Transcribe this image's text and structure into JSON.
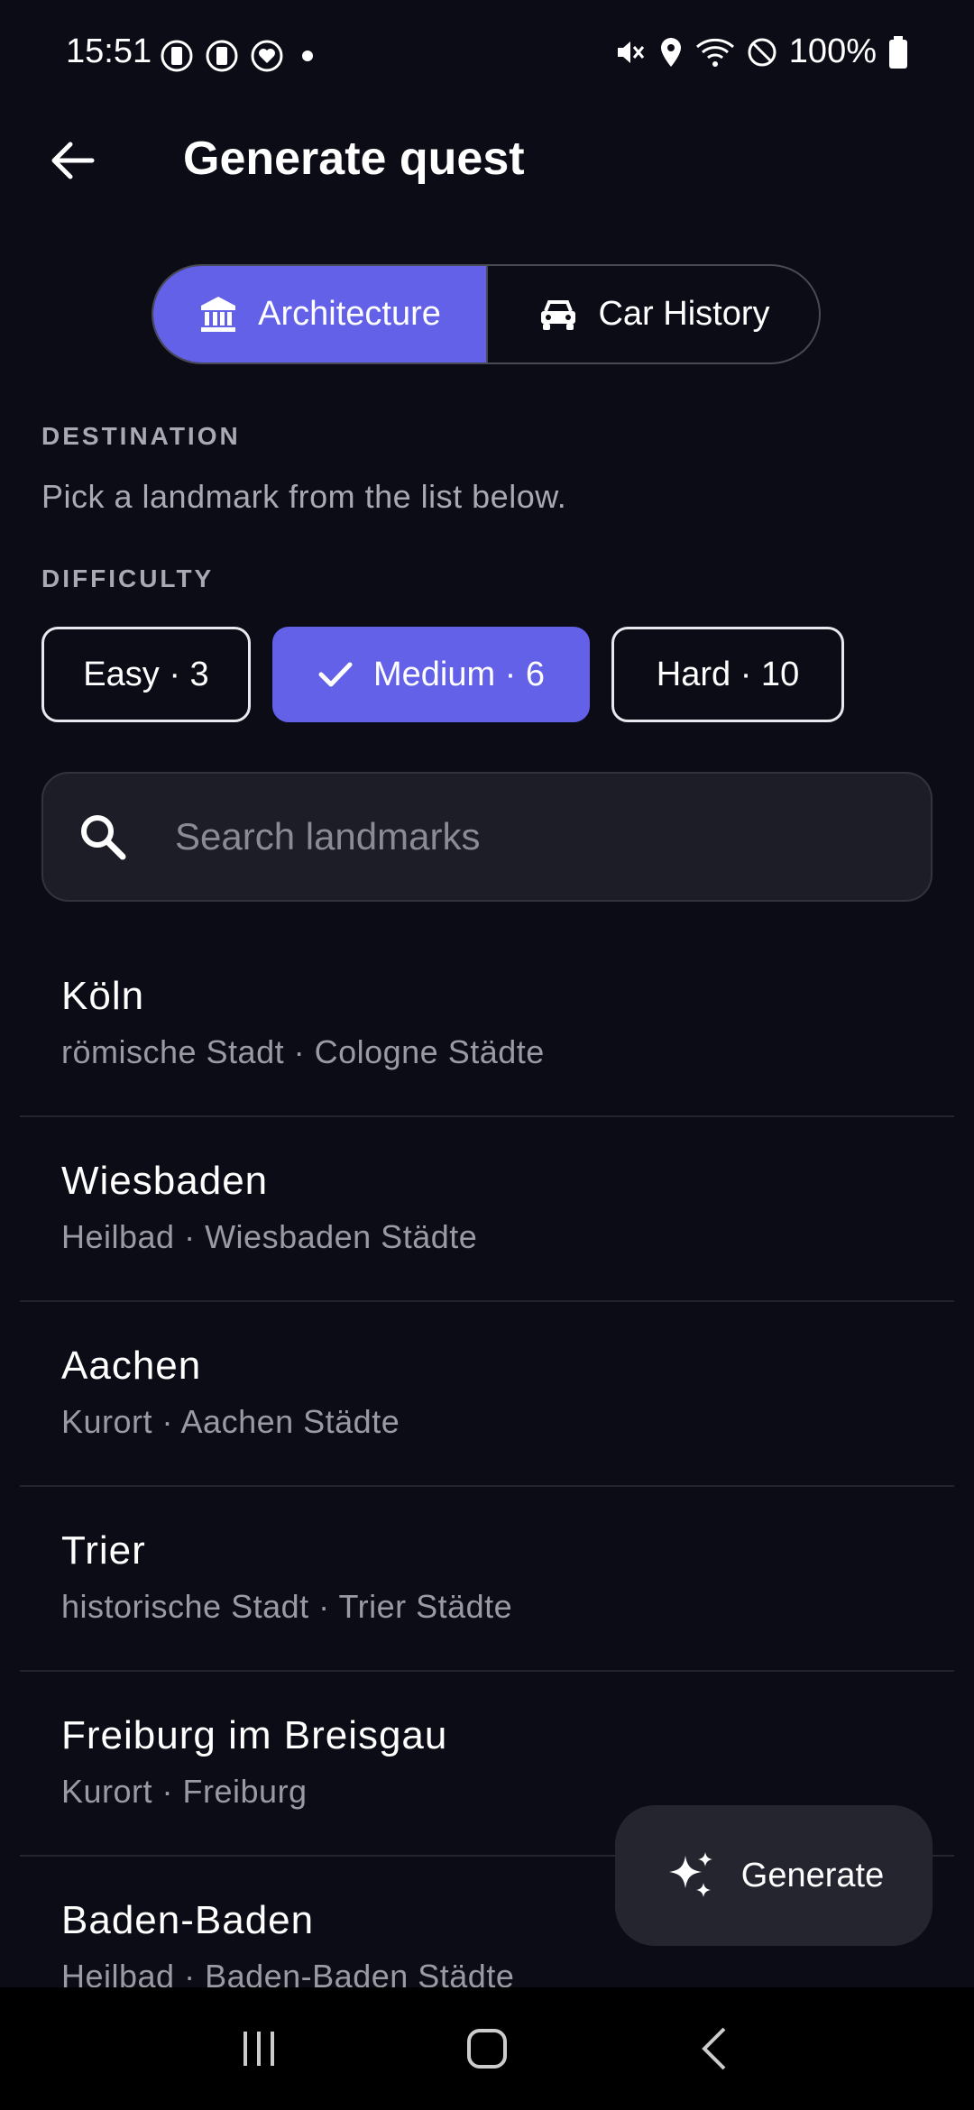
{
  "status_bar": {
    "time": "15:51",
    "battery_pct": "100%"
  },
  "app_bar": {
    "title": "Generate quest"
  },
  "segments": [
    {
      "label": "Architecture",
      "icon": "museum-icon",
      "selected": true
    },
    {
      "label": "Car History",
      "icon": "car-icon",
      "selected": false
    }
  ],
  "destination": {
    "label": "DESTINATION",
    "helper": "Pick a landmark from the list below."
  },
  "difficulty": {
    "label": "DIFFICULTY",
    "options": [
      {
        "label": "Easy · 3",
        "selected": false
      },
      {
        "label": "Medium · 6",
        "selected": true
      },
      {
        "label": "Hard · 10",
        "selected": false
      }
    ]
  },
  "search": {
    "placeholder": "Search landmarks"
  },
  "landmarks": [
    {
      "name": "Köln",
      "subtitle": "römische Stadt · Cologne Städte"
    },
    {
      "name": "Wiesbaden",
      "subtitle": "Heilbad · Wiesbaden Städte"
    },
    {
      "name": "Aachen",
      "subtitle": "Kurort · Aachen Städte"
    },
    {
      "name": "Trier",
      "subtitle": "historische Stadt · Trier Städte"
    },
    {
      "name": "Freiburg im Breisgau",
      "subtitle": "Kurort · Freiburg"
    },
    {
      "name": "Baden-Baden",
      "subtitle": "Heilbad · Baden-Baden Städte"
    }
  ],
  "fab": {
    "label": "Generate",
    "icon": "sparkle-icon"
  },
  "colors": {
    "accent": "#6361e8",
    "background": "#0c0c16"
  }
}
